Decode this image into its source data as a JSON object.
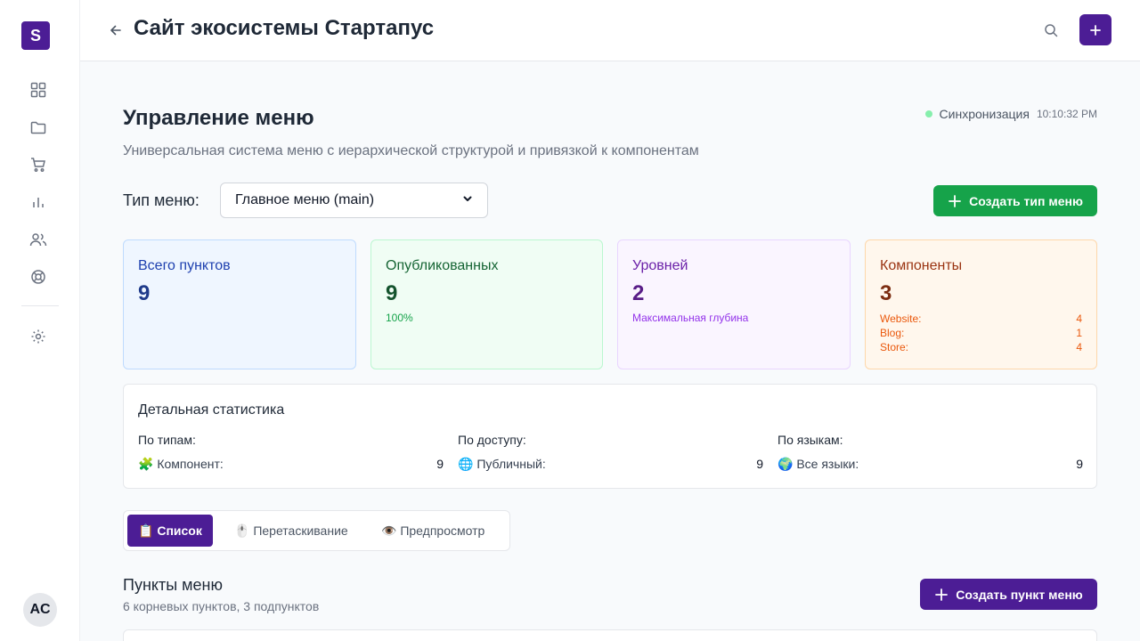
{
  "sidebar": {
    "logo": "S",
    "avatar": "AC",
    "items": [
      {
        "icon": "grid-icon"
      },
      {
        "icon": "folder-icon"
      },
      {
        "icon": "cart-icon"
      },
      {
        "icon": "bar-chart-icon"
      },
      {
        "icon": "users-icon"
      },
      {
        "icon": "lifebuoy-icon"
      },
      {
        "icon": "gear-icon"
      }
    ]
  },
  "header": {
    "title": "Сайт экосистемы Стартапус"
  },
  "page": {
    "title": "Управление меню",
    "subtitle": "Универсальная система меню с иерархической структурой и привязкой к компонентам",
    "sync_label": "Синхронизация",
    "sync_time": "10:10:32 PM"
  },
  "menu_type": {
    "label": "Тип меню:",
    "selected": "Главное меню (main)",
    "create_button": "Создать тип меню"
  },
  "stats": {
    "total": {
      "title": "Всего пунктов",
      "value": "9"
    },
    "published": {
      "title": "Опубликованных",
      "value": "9",
      "note": "100%"
    },
    "levels": {
      "title": "Уровней",
      "value": "2",
      "note": "Максимальная глубина"
    },
    "components": {
      "title": "Компоненты",
      "value": "3",
      "items": [
        {
          "label": "Website:",
          "value": "4"
        },
        {
          "label": "Blog:",
          "value": "1"
        },
        {
          "label": "Store:",
          "value": "4"
        }
      ]
    }
  },
  "detail": {
    "title": "Детальная статистика",
    "columns": [
      {
        "heading": "По типам:",
        "emoji": "🧩",
        "label": "Компонент:",
        "value": "9"
      },
      {
        "heading": "По доступу:",
        "emoji": "🌐",
        "label": "Публичный:",
        "value": "9"
      },
      {
        "heading": "По языкам:",
        "emoji": "🌍",
        "label": "Все языки:",
        "value": "9"
      }
    ]
  },
  "tabs": [
    {
      "emoji": "📋",
      "label": "Список",
      "active": true
    },
    {
      "emoji": "🖱️",
      "label": "Перетаскивание",
      "active": false
    },
    {
      "emoji": "👁️",
      "label": "Предпросмотр",
      "active": false
    }
  ],
  "items_section": {
    "title": "Пункты меню",
    "subtitle": "6 корневых пунктов, 3 подпунктов",
    "create_button": "Создать пункт меню"
  },
  "colors": {
    "brand": "#4c1d95",
    "green": "#16a34a",
    "blue_card_bg": "#eff6ff",
    "green_card_bg": "#f0fdf4",
    "purple_card_bg": "#faf5ff",
    "orange_card_bg": "#fff7ed"
  }
}
